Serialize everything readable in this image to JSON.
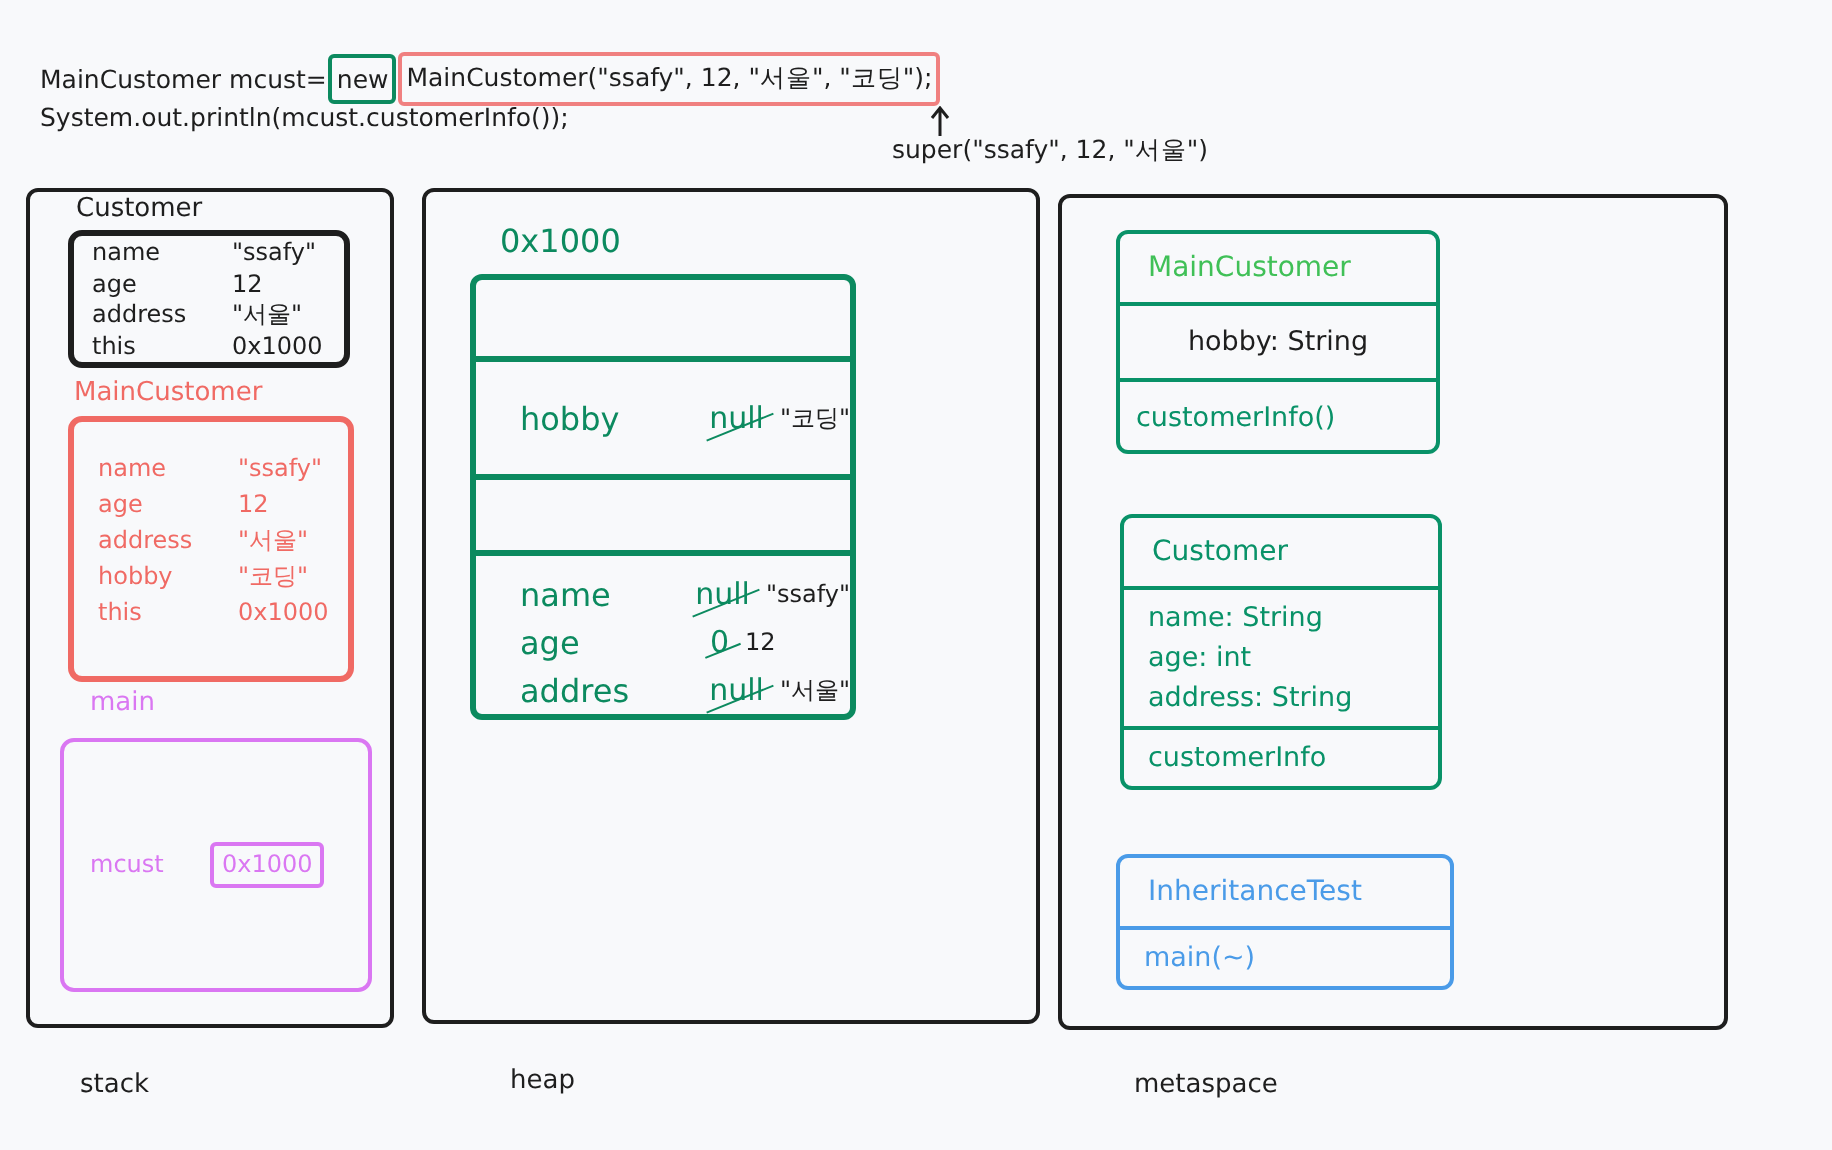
{
  "code": {
    "lines": [
      {
        "segments": [
          {
            "text": "MainCustomer mcust=",
            "kind": "plain"
          },
          {
            "text": "new",
            "kind": "boxed",
            "color": "#0c8a5f"
          },
          {
            "text": "MainCustomer(\"ssafy\", 12, \"서울\", \"코딩\");",
            "kind": "boxed",
            "color": "#f08080"
          }
        ]
      },
      {
        "segments": [
          {
            "text": "System.out.println(mcust.customerInfo());",
            "kind": "plain"
          }
        ]
      }
    ],
    "note": "super(\"ssafy\", 12, \"서울\")"
  },
  "stack": {
    "label": "stack",
    "frames": [
      {
        "title": "Customer",
        "color": "#1e1e1e",
        "fields": [
          {
            "name": "name",
            "value": "\"ssafy\"",
            "kind": "value"
          },
          {
            "name": "age",
            "value": "12",
            "kind": "value"
          },
          {
            "name": "address",
            "value": "\"서울\"",
            "kind": "value"
          },
          {
            "name": "this",
            "value": "0x1000",
            "kind": "value"
          }
        ]
      },
      {
        "title": "MainCustomer",
        "color": "#f06a64",
        "fields": [
          {
            "name": "name",
            "value": "\"ssafy\"",
            "kind": "value"
          },
          {
            "name": "age",
            "value": "12",
            "kind": "value"
          },
          {
            "name": "address",
            "value": "\"서울\"",
            "kind": "value"
          },
          {
            "name": "hobby",
            "value": "\"코딩\"",
            "kind": "value"
          },
          {
            "name": "this",
            "value": "0x1000",
            "kind": "value"
          }
        ]
      },
      {
        "title": "main",
        "color": "#da77f2",
        "fields": [
          {
            "name": "mcust",
            "value": "0x1000",
            "kind": "reference"
          }
        ]
      }
    ]
  },
  "heap": {
    "label": "heap",
    "objects": [
      {
        "address": "0x1000",
        "sections": [
          {
            "kind": "empty"
          },
          {
            "kind": "fields",
            "fields": [
              {
                "name": "hobby",
                "old": "null",
                "value": "\"코딩\""
              }
            ]
          },
          {
            "kind": "empty"
          },
          {
            "kind": "fields",
            "fields": [
              {
                "name": "name",
                "old": "null",
                "value": "\"ssafy\""
              },
              {
                "name": "age",
                "old": "0",
                "value": "12"
              },
              {
                "name": "addres",
                "old": "null",
                "value": "\"서울\""
              }
            ]
          }
        ]
      }
    ]
  },
  "metaspace": {
    "label": "metaspace",
    "classes": [
      {
        "title": {
          "text": "MainCustomer",
          "color": "#40c057"
        },
        "color": "#099268",
        "sections": [
          {
            "color": "#1e1e1e",
            "members": [
              "hobby: String"
            ]
          },
          {
            "color": "#099268",
            "members": [
              "customerInfo()"
            ]
          }
        ]
      },
      {
        "title": {
          "text": "Customer",
          "color": "#099268"
        },
        "color": "#099268",
        "sections": [
          {
            "color": "#099268",
            "members": [
              "name: String",
              "age: int",
              "address: String"
            ]
          },
          {
            "color": "#099268",
            "members": [
              "customerInfo"
            ]
          }
        ]
      },
      {
        "title": {
          "text": "InheritanceTest",
          "color": "#4a9be8"
        },
        "color": "#4a9be8",
        "sections": [
          {
            "color": "#4a9be8",
            "members": [
              "main(~)"
            ]
          }
        ]
      }
    ]
  }
}
